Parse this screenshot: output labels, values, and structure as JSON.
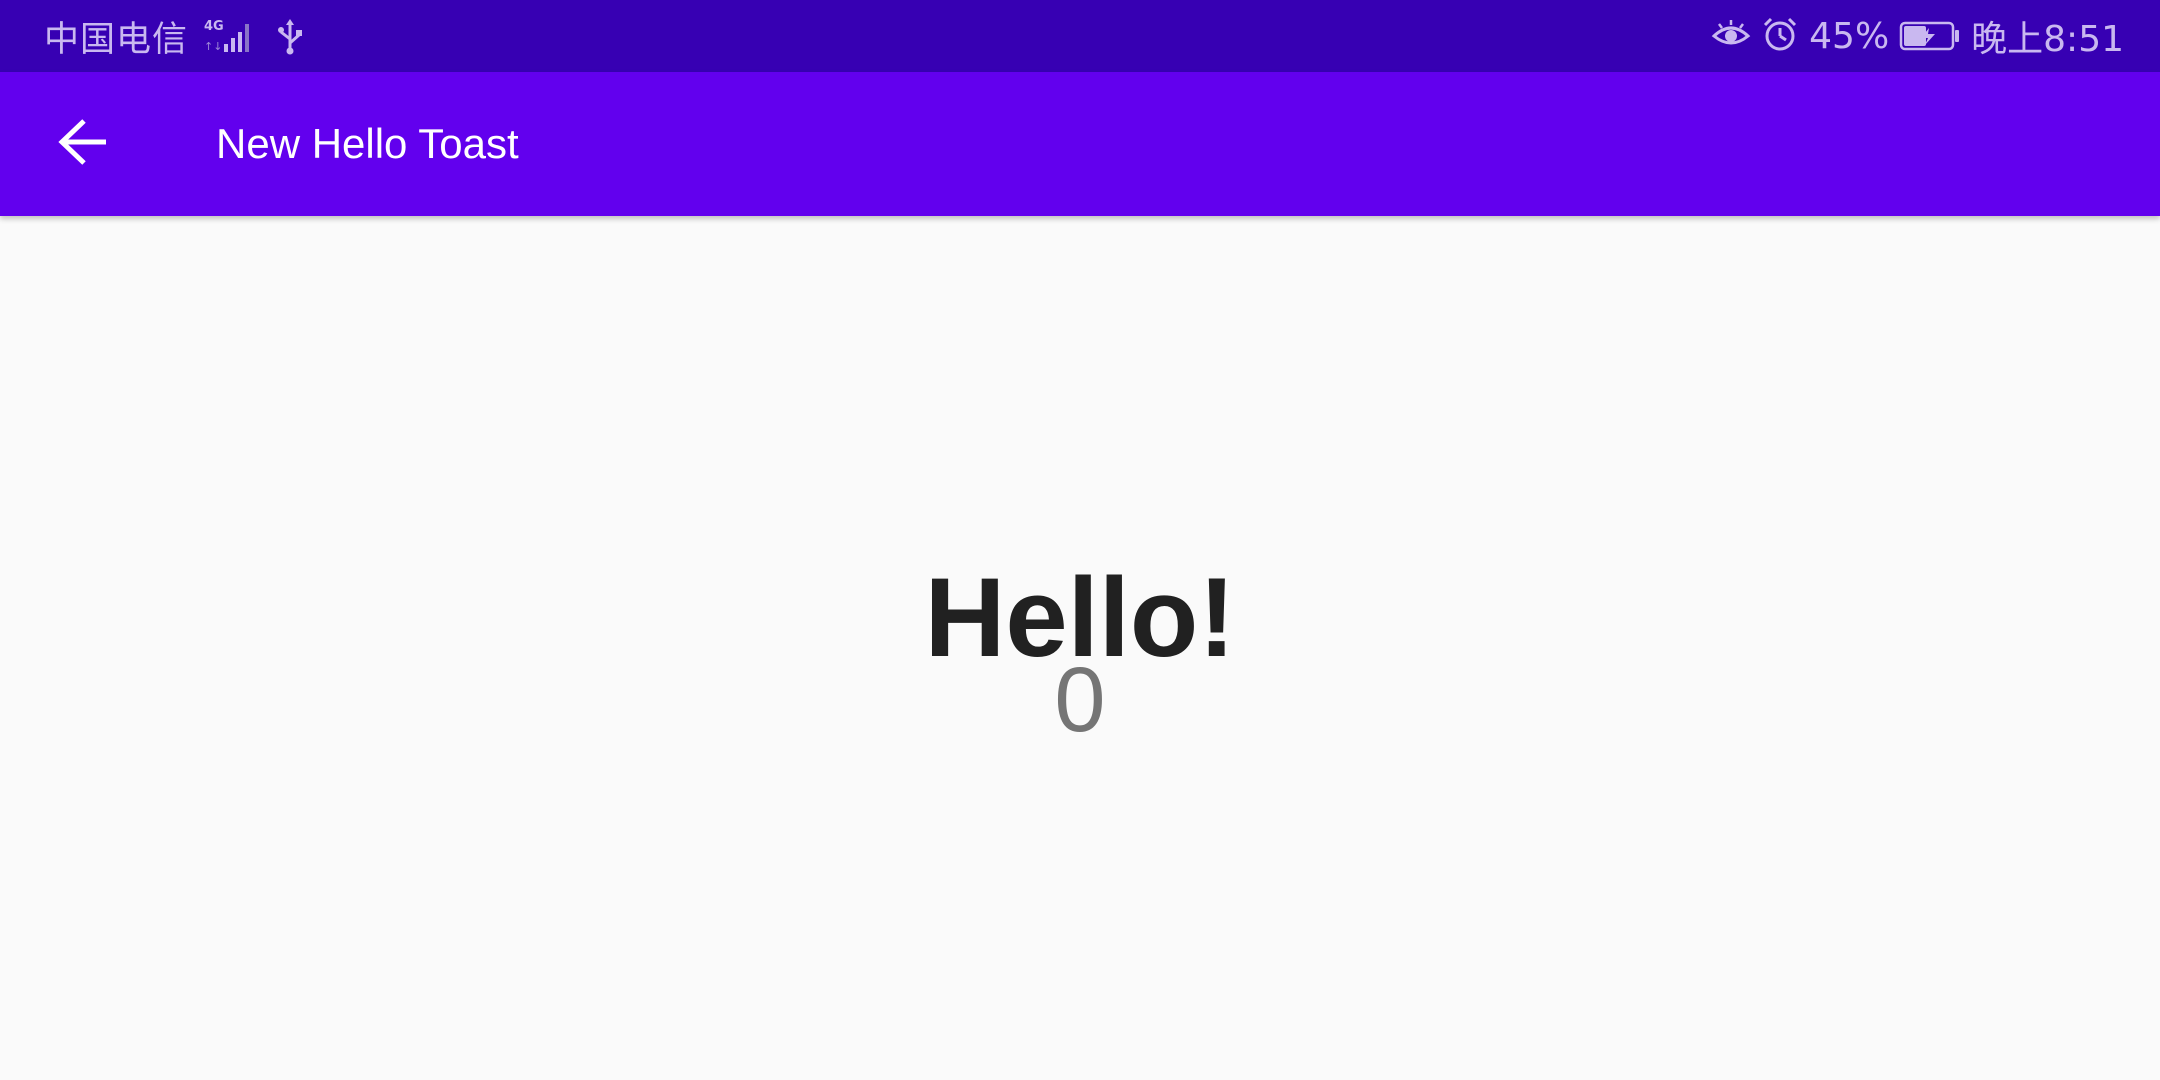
{
  "status_bar": {
    "carrier": "中国电信",
    "network_type": "4G",
    "battery_percent": "45%",
    "time": "晚上8:51",
    "icons": [
      "signal-icon",
      "usb-icon",
      "eye-comfort-icon",
      "alarm-icon",
      "battery-charging-icon"
    ]
  },
  "app_bar": {
    "title": "New Hello Toast",
    "back_icon": "arrow-back-icon"
  },
  "main": {
    "greeting": "Hello!",
    "count": "0"
  },
  "colors": {
    "status_bar_bg": "#3700b3",
    "app_bar_bg": "#6200ee",
    "page_bg": "#fafafa",
    "greeting_text": "#212121",
    "count_text": "#757575"
  }
}
